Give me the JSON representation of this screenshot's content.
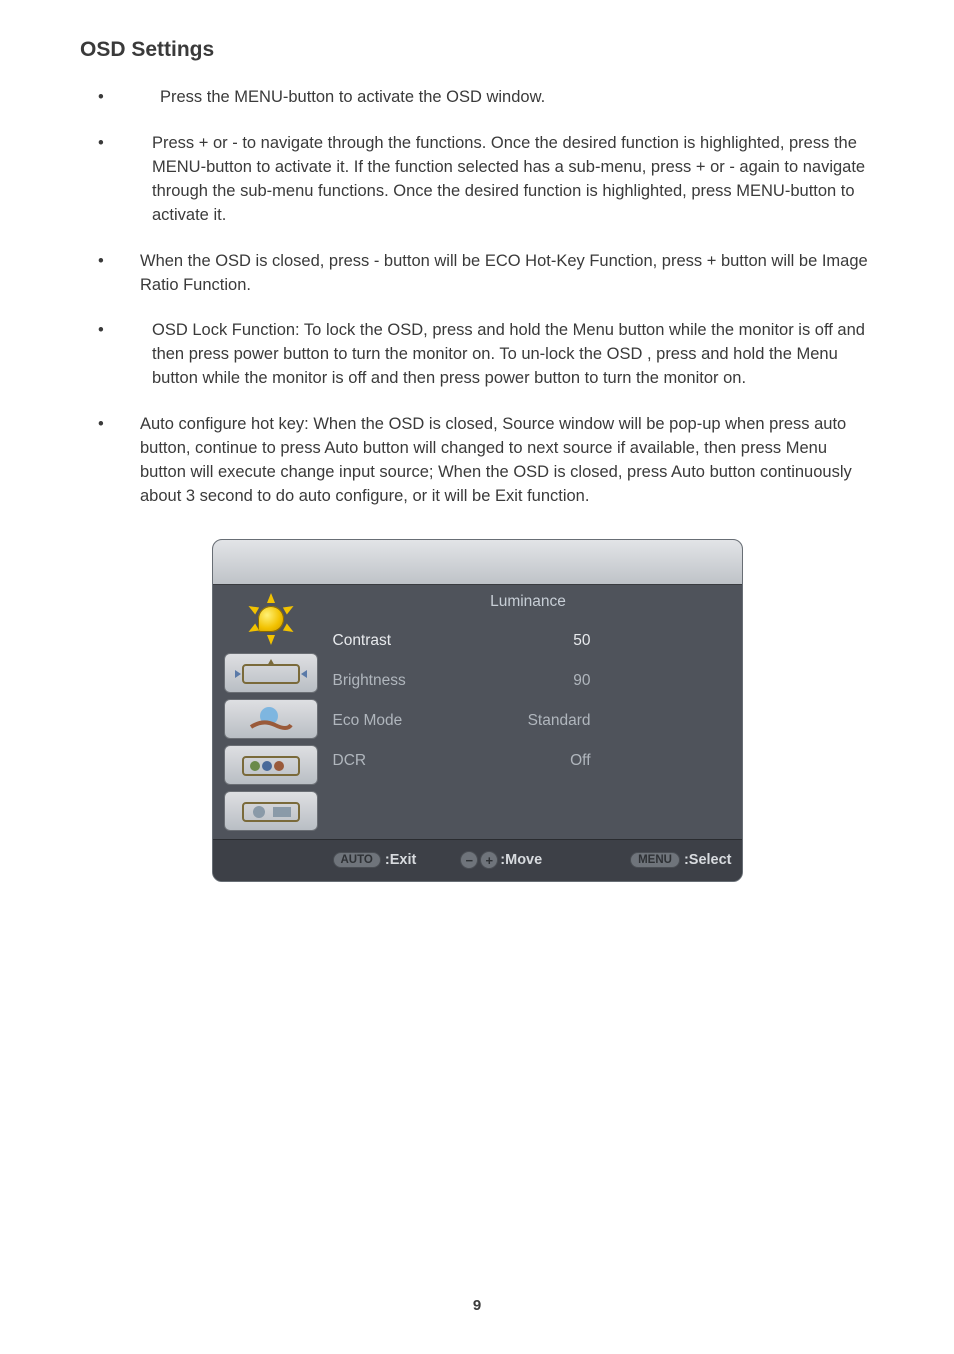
{
  "title": "OSD Settings",
  "bullets": [
    "Press the MENU-button to activate the OSD window.",
    "Press + or - to navigate through the functions. Once the desired function is highlighted, press the MENU-button to activate it. If the function selected has a sub-menu, press + or -  again to navigate through the sub-menu functions. Once the desired function is highlighted, press MENU-button to activate it.",
    "When the OSD is closed, press - button will be ECO Hot-Key Function, press + button will be Image Ratio Function.",
    "OSD Lock Function: To lock the OSD, press and hold the Menu button while the monitor is off and then press power button to turn the monitor on. To un-lock the OSD , press and hold the Menu button while the monitor is off and then press power button to turn the monitor on.",
    "Auto configure hot key: When the OSD is closed, Source window will be pop-up when press auto button, continue to press Auto button will changed to next source if available, then press Menu button will execute change input source; When the OSD is closed, press Auto button continuously about 3 second to do auto configure, or it will be Exit function."
  ],
  "osd": {
    "heading": "Luminance",
    "rows": [
      {
        "label": "Contrast",
        "value": "50",
        "selected": true
      },
      {
        "label": "Brightness",
        "value": "90",
        "selected": false
      },
      {
        "label": "Eco Mode",
        "value": "Standard",
        "selected": false
      },
      {
        "label": "DCR",
        "value": "Off",
        "selected": false
      }
    ],
    "footer": {
      "auto_pill": "AUTO",
      "exit_label": ":Exit",
      "move_label": ":Move",
      "menu_pill": "MENU",
      "select_label": ":Select"
    }
  },
  "page_number": "9"
}
